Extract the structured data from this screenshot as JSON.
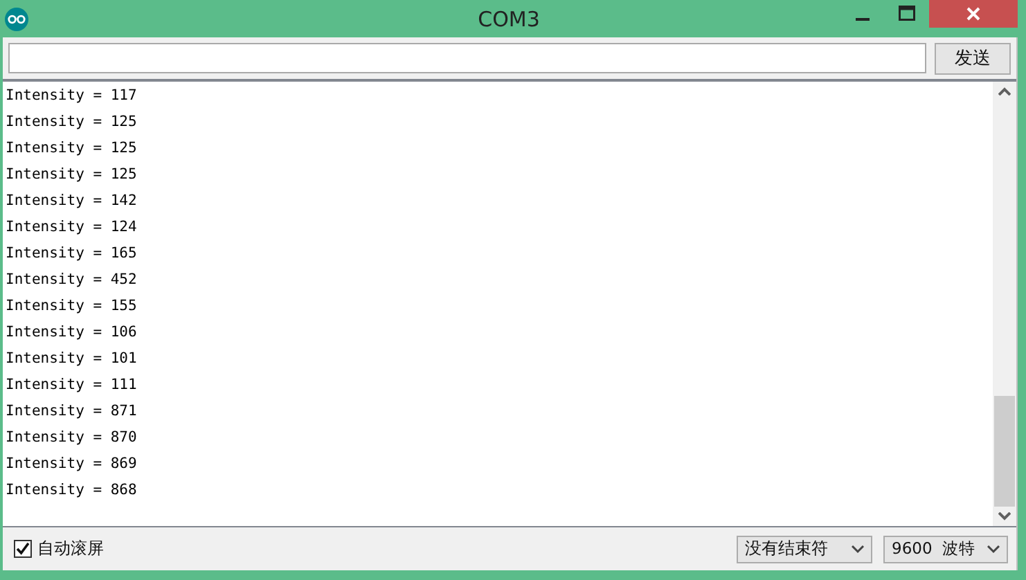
{
  "window": {
    "title": "COM3"
  },
  "send": {
    "button": "发送"
  },
  "output": {
    "lines": [
      "Intensity = 117",
      "Intensity = 125",
      "Intensity = 125",
      "Intensity = 125",
      "Intensity = 142",
      "Intensity = 124",
      "Intensity = 165",
      "Intensity = 452",
      "Intensity = 155",
      "Intensity = 106",
      "Intensity = 101",
      "Intensity = 111",
      "Intensity = 871",
      "Intensity = 870",
      "Intensity = 869",
      "Intensity = 868"
    ]
  },
  "footer": {
    "autoscroll": {
      "label": "自动滚屏",
      "checked": true
    },
    "line_ending": "没有结束符",
    "baud": "9600  波特"
  }
}
